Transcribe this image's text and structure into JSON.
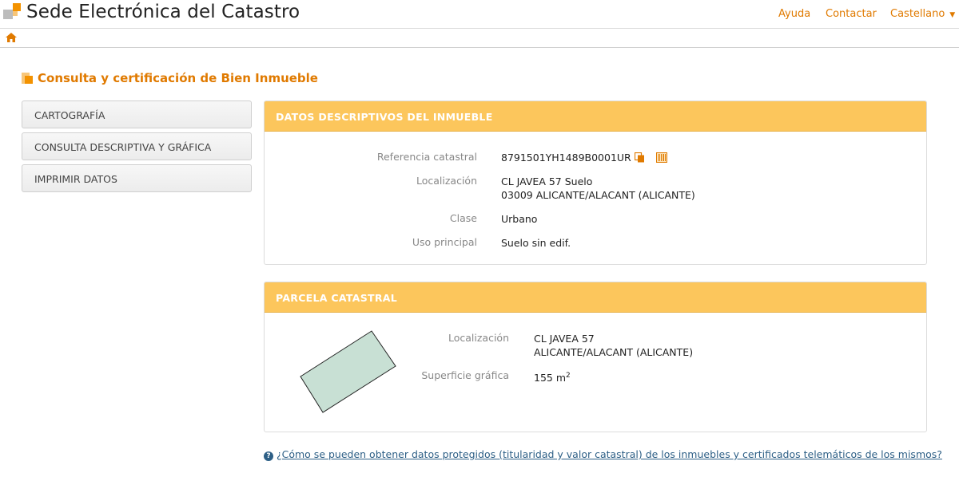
{
  "header": {
    "site_title": "Sede Electrónica del Catastro",
    "links": {
      "ayuda": "Ayuda",
      "contactar": "Contactar",
      "language": "Castellano"
    }
  },
  "page": {
    "title": "Consulta y certificación de Bien Inmueble"
  },
  "sidebar": {
    "items": [
      {
        "label": "CARTOGRAFÍA"
      },
      {
        "label": "CONSULTA DESCRIPTIVA Y GRÁFICA"
      },
      {
        "label": "IMPRIMIR DATOS"
      }
    ]
  },
  "descriptivos": {
    "heading": "DATOS DESCRIPTIVOS DEL INMUEBLE",
    "referencia_label": "Referencia catastral",
    "referencia_value": "8791501YH1489B0001UR",
    "localizacion_label": "Localización",
    "localizacion_line1": "CL JAVEA 57 Suelo",
    "localizacion_line2": "03009 ALICANTE/ALACANT (ALICANTE)",
    "clase_label": "Clase",
    "clase_value": "Urbano",
    "uso_label": "Uso principal",
    "uso_value": "Suelo sin edif."
  },
  "parcela": {
    "heading": "PARCELA CATASTRAL",
    "localizacion_label": "Localización",
    "localizacion_line1": "CL JAVEA 57",
    "localizacion_line2": "ALICANTE/ALACANT (ALICANTE)",
    "superficie_label": "Superficie gráfica",
    "superficie_value": "155 m",
    "superficie_unit_sup": "2"
  },
  "footer": {
    "help_link": "¿Cómo se pueden obtener datos protegidos (titularidad y valor catastral) de los inmuebles y certificados telemáticos de los mismos?"
  },
  "colors": {
    "accent": "#e07a00",
    "panel_header": "#fcc65c",
    "parcel_fill": "#c8e0d4",
    "link": "#2d5f86"
  },
  "icons": {
    "logo": "catastro-logo",
    "home": "home-icon",
    "title": "square-bullet-icon",
    "copy": "copy-icon",
    "barcode": "barcode-icon",
    "help": "question-circle-icon",
    "caret": "caret-down-icon"
  }
}
